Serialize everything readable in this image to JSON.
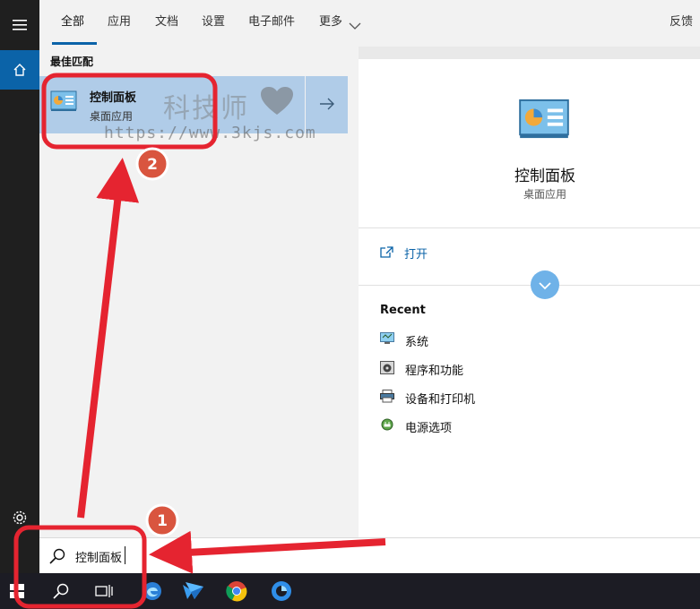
{
  "tabs": [
    "全部",
    "应用",
    "文档",
    "设置",
    "电子邮件",
    "更多"
  ],
  "feedback": "反馈",
  "best_match": {
    "section_label": "最佳匹配",
    "title": "控制面板",
    "subtitle": "桌面应用"
  },
  "watermark": {
    "text": "科技师",
    "url": "https://www.3kjs.com"
  },
  "preview": {
    "title": "控制面板",
    "subtitle": "桌面应用",
    "open_label": "打开",
    "recent_label": "Recent",
    "recent_items": [
      "系统",
      "程序和功能",
      "设备和打印机",
      "电源选项"
    ]
  },
  "search": {
    "value": "控制面板"
  },
  "annotations": {
    "badge1": "1",
    "badge2": "2",
    "color": "#e52430",
    "badge_color": "#d9553f"
  },
  "icons": {
    "rail": [
      "hamburger-icon",
      "home-icon",
      "gear-icon"
    ],
    "taskbar": [
      "start-icon",
      "search-icon",
      "task-view-icon",
      "edge-icon",
      "feishu-icon",
      "chrome-icon",
      "browser-icon"
    ]
  }
}
